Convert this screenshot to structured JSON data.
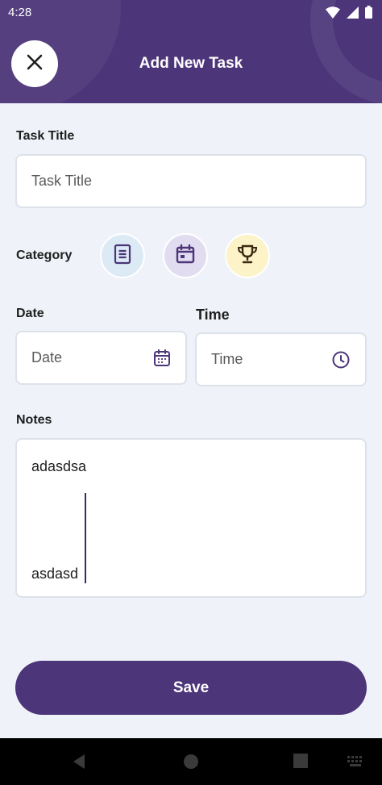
{
  "status_bar": {
    "time": "4:28"
  },
  "header": {
    "title": "Add New Task"
  },
  "task_title": {
    "label": "Task Title",
    "placeholder": "Task Title",
    "value": ""
  },
  "category": {
    "label": "Category",
    "options": [
      {
        "icon": "notes-icon",
        "bg": "#dceaf5",
        "color": "#4c3579"
      },
      {
        "icon": "calendar-icon",
        "bg": "#e2dcf0",
        "color": "#4c3579"
      },
      {
        "icon": "trophy-icon",
        "bg": "#fdf3c8",
        "color": "#3b2a12"
      }
    ]
  },
  "date": {
    "label": "Date",
    "placeholder": "Date"
  },
  "time": {
    "label": "Time",
    "placeholder": "Time"
  },
  "notes": {
    "label": "Notes",
    "lines": [
      "adasdsa",
      "asdasd"
    ]
  },
  "save_label": "Save",
  "colors": {
    "primary": "#4c3579",
    "background": "#eff3f9"
  }
}
